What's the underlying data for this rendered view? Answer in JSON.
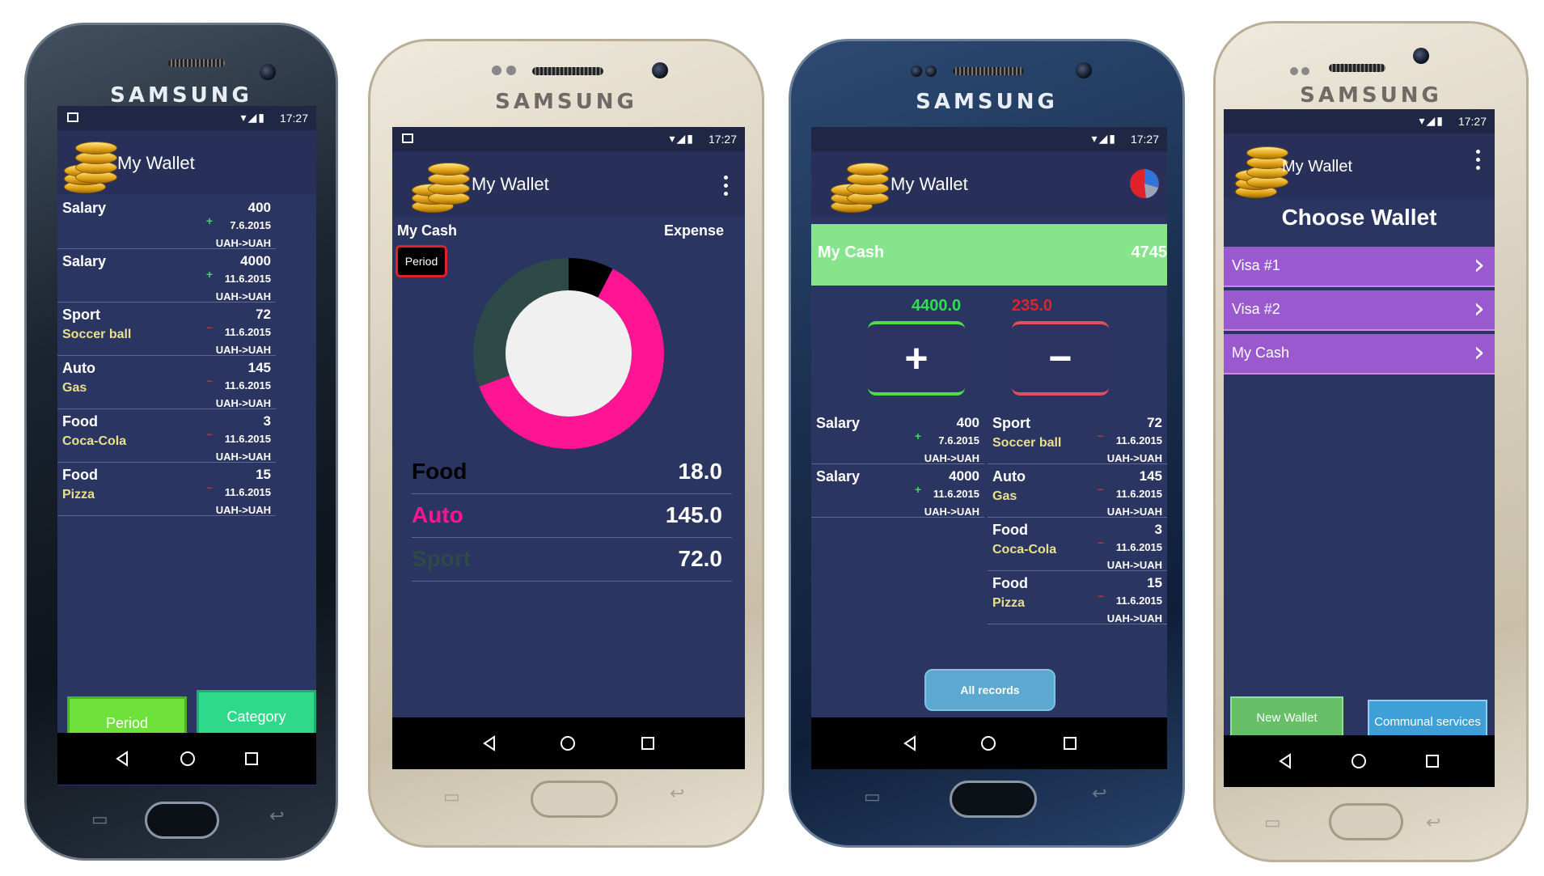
{
  "device": {
    "brand": "SAMSUNG"
  },
  "status": {
    "time": "17:27"
  },
  "app": {
    "title": "My Wallet"
  },
  "screen1": {
    "records": [
      {
        "category": "Salary",
        "subcategory": "",
        "amount": "400",
        "date": "7.6.2015",
        "currency": "UAH->UAH",
        "type": "income"
      },
      {
        "category": "Salary",
        "subcategory": "",
        "amount": "4000",
        "date": "11.6.2015",
        "currency": "UAH->UAH",
        "type": "income"
      },
      {
        "category": "Sport",
        "subcategory": "Soccer ball",
        "amount": "72",
        "date": "11.6.2015",
        "currency": "UAH->UAH",
        "type": "expense"
      },
      {
        "category": "Auto",
        "subcategory": "Gas",
        "amount": "145",
        "date": "11.6.2015",
        "currency": "UAH->UAH",
        "type": "expense"
      },
      {
        "category": "Food",
        "subcategory": "Coca-Cola",
        "amount": "3",
        "date": "11.6.2015",
        "currency": "UAH->UAH",
        "type": "expense"
      },
      {
        "category": "Food",
        "subcategory": "Pizza",
        "amount": "15",
        "date": "11.6.2015",
        "currency": "UAH->UAH",
        "type": "expense"
      }
    ],
    "buttons": {
      "period": "Period",
      "category": "Category"
    },
    "colors": {
      "period": "#6ee23a",
      "category": "#2ed98a"
    }
  },
  "screen2": {
    "wallet_label": "My Cash",
    "mode_label": "Expense",
    "period_button": "Period",
    "chart_data": {
      "type": "pie",
      "categories": [
        "Food",
        "Auto",
        "Sport"
      ],
      "values": [
        18.0,
        145.0,
        72.0
      ],
      "colors": [
        "#000000",
        "#ff1493",
        "#2e4a48"
      ],
      "value_labels": [
        "18.0",
        "145.0",
        "72.0"
      ]
    }
  },
  "screen3": {
    "wallet_name": "My Cash",
    "wallet_balance": "4745",
    "income_total": "4400.0",
    "expense_total": "235.0",
    "add_symbol": "+",
    "sub_symbol": "−",
    "income_records": [
      {
        "category": "Salary",
        "amount": "400",
        "date": "7.6.2015",
        "currency": "UAH->UAH"
      },
      {
        "category": "Salary",
        "amount": "4000",
        "date": "11.6.2015",
        "currency": "UAH->UAH"
      }
    ],
    "expense_records": [
      {
        "category": "Sport",
        "subcategory": "Soccer ball",
        "amount": "72",
        "date": "11.6.2015",
        "currency": "UAH->UAH"
      },
      {
        "category": "Auto",
        "subcategory": "Gas",
        "amount": "145",
        "date": "11.6.2015",
        "currency": "UAH->UAH"
      },
      {
        "category": "Food",
        "subcategory": "Coca-Cola",
        "amount": "3",
        "date": "11.6.2015",
        "currency": "UAH->UAH"
      },
      {
        "category": "Food",
        "subcategory": "Pizza",
        "amount": "15",
        "date": "11.6.2015",
        "currency": "UAH->UAH"
      }
    ],
    "all_records_button": "All records",
    "colors": {
      "wallet_bar": "#86e58b",
      "income": "#2ee04f",
      "expense": "#e0222a"
    }
  },
  "screen4": {
    "heading": "Choose Wallet",
    "wallets": [
      "Visa #1",
      "Visa #2",
      "My Cash"
    ],
    "buttons": {
      "new_wallet": "New Wallet",
      "communal": "Communal services"
    },
    "colors": {
      "wallet_item": "#9b59d0",
      "new_wallet": "#67c067",
      "communal": "#3fa0d8"
    }
  }
}
